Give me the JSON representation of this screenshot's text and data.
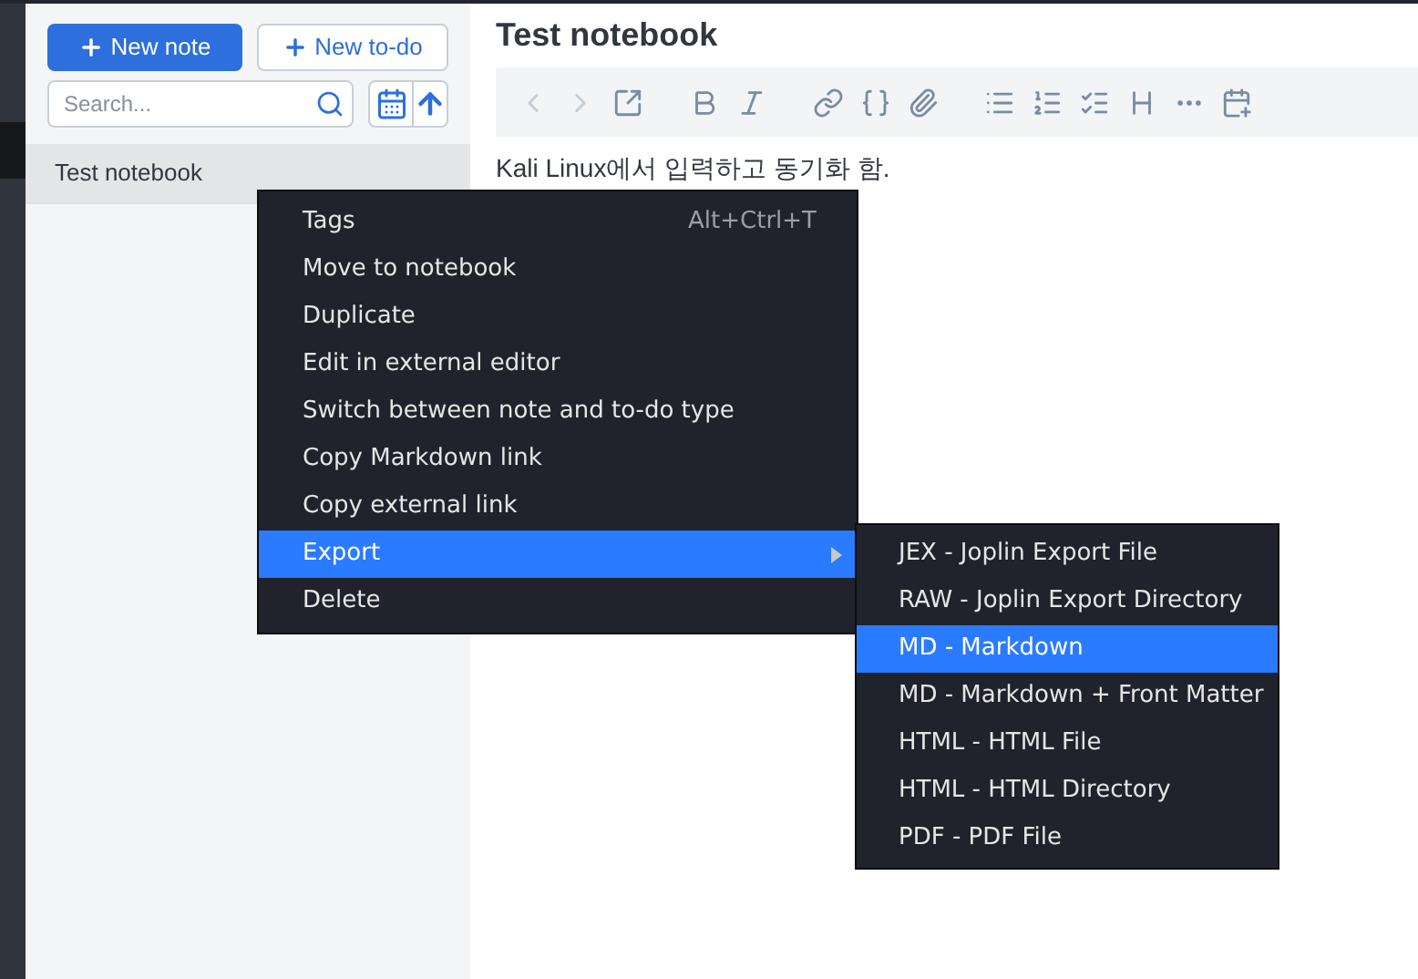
{
  "sidebar": {
    "new_note_button": "New note",
    "new_todo_button": "New to-do",
    "search": {
      "placeholder": "Search..."
    },
    "notes": [
      {
        "title": "Test notebook",
        "selected": true
      }
    ]
  },
  "editor": {
    "title": "Test notebook",
    "body": "Kali Linux에서 입력하고 동기화 함."
  },
  "context_menu": {
    "items": [
      {
        "label": "Tags",
        "shortcut": "Alt+Ctrl+T",
        "selected": false,
        "submenu": false
      },
      {
        "label": "Move to notebook",
        "selected": false,
        "submenu": false
      },
      {
        "label": "Duplicate",
        "selected": false,
        "submenu": false
      },
      {
        "label": "Edit in external editor",
        "selected": false,
        "submenu": false
      },
      {
        "label": "Switch between note and to-do type",
        "selected": false,
        "submenu": false
      },
      {
        "label": "Copy Markdown link",
        "selected": false,
        "submenu": false
      },
      {
        "label": "Copy external link",
        "selected": false,
        "submenu": false
      },
      {
        "label": "Export",
        "selected": true,
        "submenu": true
      },
      {
        "label": "Delete",
        "selected": false,
        "submenu": false
      }
    ]
  },
  "export_submenu": {
    "items": [
      {
        "label": "JEX - Joplin Export File",
        "selected": false
      },
      {
        "label": "RAW - Joplin Export Directory",
        "selected": false
      },
      {
        "label": "MD - Markdown",
        "selected": true
      },
      {
        "label": "MD - Markdown + Front Matter",
        "selected": false
      },
      {
        "label": "HTML - HTML File",
        "selected": false
      },
      {
        "label": "HTML - HTML Directory",
        "selected": false
      },
      {
        "label": "PDF - PDF File",
        "selected": false
      }
    ]
  }
}
